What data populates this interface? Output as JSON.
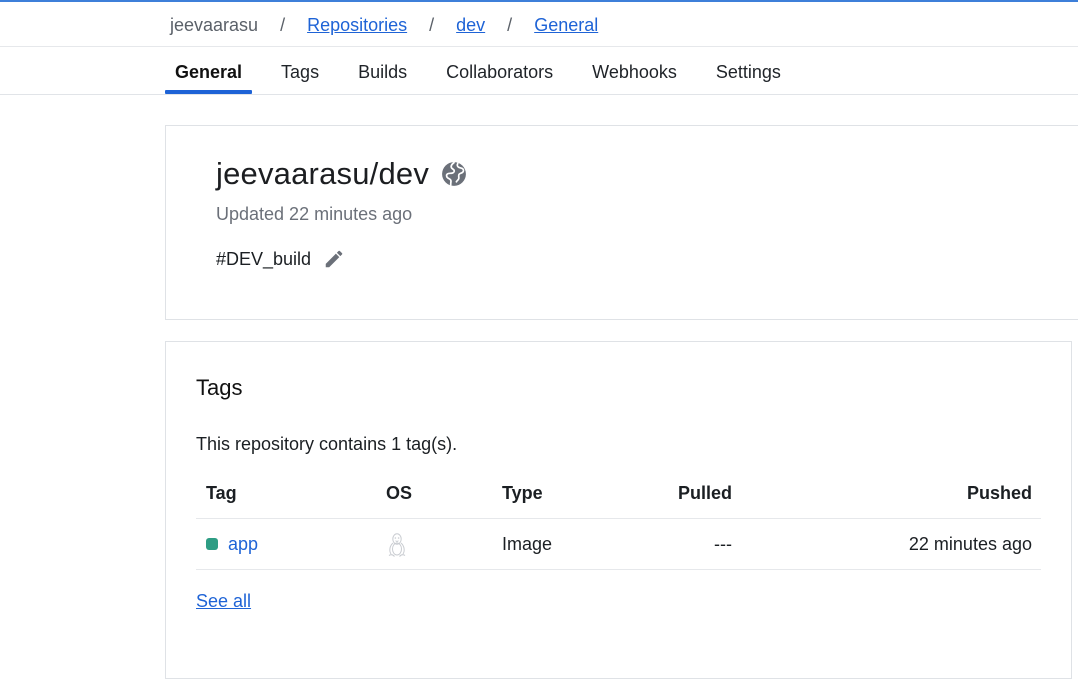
{
  "breadcrumb": {
    "user": "jeevaarasu",
    "separator": "/",
    "repositories": "Repositories",
    "repo": "dev",
    "current": "General"
  },
  "tabs": [
    {
      "label": "General",
      "active": true
    },
    {
      "label": "Tags",
      "active": false
    },
    {
      "label": "Builds",
      "active": false
    },
    {
      "label": "Collaborators",
      "active": false
    },
    {
      "label": "Webhooks",
      "active": false
    },
    {
      "label": "Settings",
      "active": false
    }
  ],
  "repo": {
    "title": "jeevaarasu/dev",
    "visibility_icon": "globe-icon",
    "updated": "Updated 22 minutes ago",
    "description": "#DEV_build",
    "edit_icon": "pencil-icon"
  },
  "tags_section": {
    "heading": "Tags",
    "summary": "This repository contains 1 tag(s).",
    "columns": {
      "tag": "Tag",
      "os": "OS",
      "type": "Type",
      "pulled": "Pulled",
      "pushed": "Pushed"
    },
    "rows": [
      {
        "tag": "app",
        "os_icon": "linux-icon",
        "type": "Image",
        "pulled": "---",
        "pushed": "22 minutes ago"
      }
    ],
    "see_all": "See all"
  },
  "colors": {
    "accent": "#1e63d6",
    "tag_status": "#2e9d84",
    "icon_gray": "#6b7079"
  }
}
